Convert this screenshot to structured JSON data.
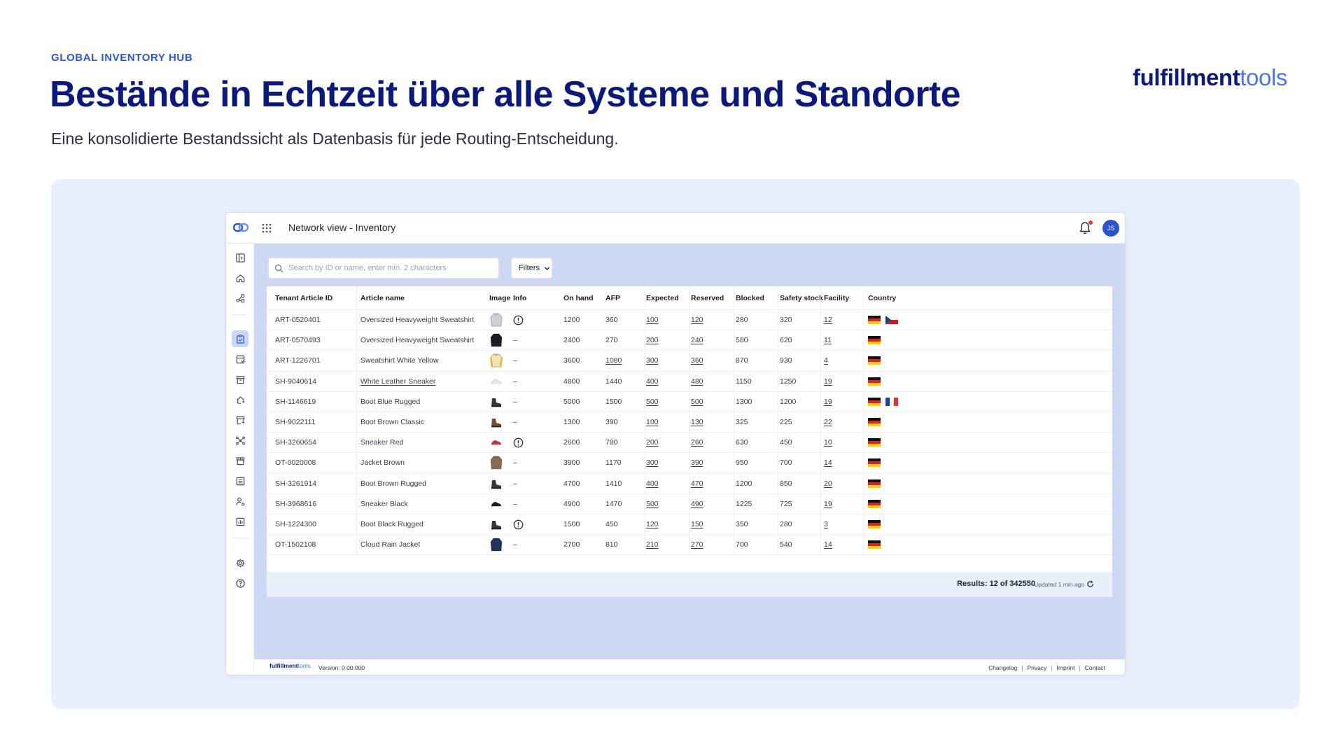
{
  "slide": {
    "eyebrow": "GLOBAL INVENTORY HUB",
    "headline": "Bestände in Echtzeit über alle Systeme und Standorte",
    "subline": "Eine konsolidierte Bestandssicht als Datenbasis für jede Routing-Entscheidung.",
    "brand_main": "fulfillment",
    "brand_accent": "tools"
  },
  "app": {
    "title": "Network view - Inventory",
    "avatar_initials": "JS",
    "search": {
      "placeholder": "Search by ID or name, enter min. 2 characters",
      "value": ""
    },
    "filters_label": "Filters",
    "nav_icons": [
      "sidebar-toggle-icon",
      "home-icon",
      "network-icon",
      "inventory-clipboard-icon",
      "stock-list-icon",
      "archive-box-icon",
      "routing-home-icon",
      "store-return-icon",
      "hub-icon",
      "storefront-icon",
      "document-list-icon",
      "user-settings-icon",
      "analytics-icon",
      "settings-gear-icon",
      "help-icon"
    ],
    "table": {
      "columns": [
        "Tenant Article ID",
        "Article name",
        "Image",
        "Info",
        "On hand",
        "AFP",
        "Expected",
        "Reserved",
        "Blocked",
        "Safety stock",
        "Facility",
        "Country"
      ],
      "rows": [
        {
          "id": "ART-0520401",
          "name": "Oversized Heavyweight Sweatshirt",
          "image": "sweatshirt-grey",
          "info": "alert",
          "on_hand": "1200",
          "afp": "360",
          "expected": "100",
          "reserved": "120",
          "blocked": "280",
          "safety": "320",
          "facility": "12",
          "countries": [
            "de",
            "cz"
          ]
        },
        {
          "id": "ART-0570493",
          "name": "Oversized Heavyweight Sweatshirt",
          "image": "sweatshirt-black",
          "info": "–",
          "on_hand": "2400",
          "afp": "270",
          "expected": "200",
          "reserved": "240",
          "blocked": "580",
          "safety": "620",
          "facility": "11",
          "countries": [
            "de"
          ]
        },
        {
          "id": "ART-1226701",
          "name": "Sweatshirt White Yellow",
          "image": "sweatshirt-yellow",
          "info": "–",
          "on_hand": "3600",
          "afp": "1080",
          "expected": "300",
          "reserved": "360",
          "blocked": "870",
          "safety": "930",
          "facility": "4",
          "countries": [
            "de"
          ]
        },
        {
          "id": "SH-9040614",
          "name": "White Leather Sneaker",
          "image": "sneaker-white",
          "info": "–",
          "on_hand": "4800",
          "afp": "1440",
          "expected": "400",
          "reserved": "480",
          "blocked": "1150",
          "safety": "1250",
          "facility": "19",
          "countries": [
            "de"
          ]
        },
        {
          "id": "SH-1146619",
          "name": "Boot Blue Rugged",
          "image": "boot-dark",
          "info": "–",
          "on_hand": "5000",
          "afp": "1500",
          "expected": "500",
          "reserved": "500",
          "blocked": "1300",
          "safety": "1200",
          "facility": "19",
          "countries": [
            "de",
            "fr"
          ]
        },
        {
          "id": "SH-9022111",
          "name": "Boot Brown Classic",
          "image": "boot-brown",
          "info": "–",
          "on_hand": "1300",
          "afp": "390",
          "expected": "100",
          "reserved": "130",
          "blocked": "325",
          "safety": "225",
          "facility": "22",
          "countries": [
            "de"
          ]
        },
        {
          "id": "SH-3260654",
          "name": "Sneaker Red",
          "image": "sneaker-red",
          "info": "alert",
          "on_hand": "2600",
          "afp": "780",
          "expected": "200",
          "reserved": "260",
          "blocked": "630",
          "safety": "450",
          "facility": "10",
          "countries": [
            "de"
          ]
        },
        {
          "id": "OT-0020008",
          "name": "Jacket Brown",
          "image": "jacket-brown",
          "info": "–",
          "on_hand": "3900",
          "afp": "1170",
          "expected": "300",
          "reserved": "390",
          "blocked": "950",
          "safety": "700",
          "facility": "14",
          "countries": [
            "de"
          ]
        },
        {
          "id": "SH-3261914",
          "name": "Boot Brown Rugged",
          "image": "boot-dark",
          "info": "–",
          "on_hand": "4700",
          "afp": "1410",
          "expected": "400",
          "reserved": "470",
          "blocked": "1200",
          "safety": "850",
          "facility": "20",
          "countries": [
            "de"
          ]
        },
        {
          "id": "SH-3968616",
          "name": "Sneaker Black",
          "image": "sneaker-black",
          "info": "–",
          "on_hand": "4900",
          "afp": "1470",
          "expected": "500",
          "reserved": "490",
          "blocked": "1225",
          "safety": "725",
          "facility": "19",
          "countries": [
            "de"
          ]
        },
        {
          "id": "SH-1224300",
          "name": "Boot Black Rugged",
          "image": "boot-dark",
          "info": "alert",
          "on_hand": "1500",
          "afp": "450",
          "expected": "120",
          "reserved": "150",
          "blocked": "350",
          "safety": "280",
          "facility": "3",
          "countries": [
            "de"
          ]
        },
        {
          "id": "OT-1502108",
          "name": "Cloud Rain Jacket",
          "image": "jacket-navy",
          "info": "–",
          "on_hand": "2700",
          "afp": "810",
          "expected": "210",
          "reserved": "270",
          "blocked": "700",
          "safety": "540",
          "facility": "14",
          "countries": [
            "de"
          ]
        }
      ]
    },
    "results_text": "Results: 12 of 342550",
    "updated_text": "Updated 1 min ago",
    "footer": {
      "brand_main": "fulfillment",
      "brand_accent": "tools",
      "version": "Version: 0.00.000",
      "links": [
        "Changelog",
        "Privacy",
        "Imprint",
        "Contact"
      ]
    }
  },
  "colors": {
    "headline": "#0b1a7a",
    "accent": "#2f55d4",
    "stage_bg": "#e9effd",
    "content_bg": "#ced8f3"
  }
}
